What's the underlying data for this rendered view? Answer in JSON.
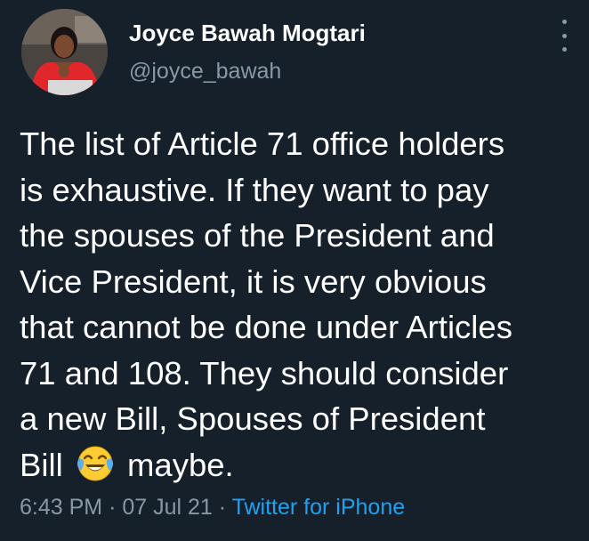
{
  "author": {
    "display_name": "Joyce Bawah Mogtari",
    "handle": "@joyce_bawah",
    "avatar_icon": "profile-photo"
  },
  "menu": {
    "icon": "more-vertical-icon"
  },
  "tweet": {
    "lines": [
      "The list of Article 71 office holders",
      "is exhaustive. If they want to pay",
      "the spouses of the President and",
      "Vice President, it is very obvious",
      "that cannot be done under Articles",
      "71 and 108. They should consider",
      "a new Bill,  Spouses of President"
    ],
    "last_line_before_emoji": "Bill",
    "emoji": "face-with-tears-of-joy",
    "last_line_after_emoji": "maybe."
  },
  "meta": {
    "time": "6:43 PM",
    "separator": "·",
    "date": "07 Jul 21",
    "source": "Twitter for iPhone"
  },
  "colors": {
    "background": "#15202b",
    "text": "#ffffff",
    "secondary": "#8899a6",
    "link": "#1da1f2"
  }
}
